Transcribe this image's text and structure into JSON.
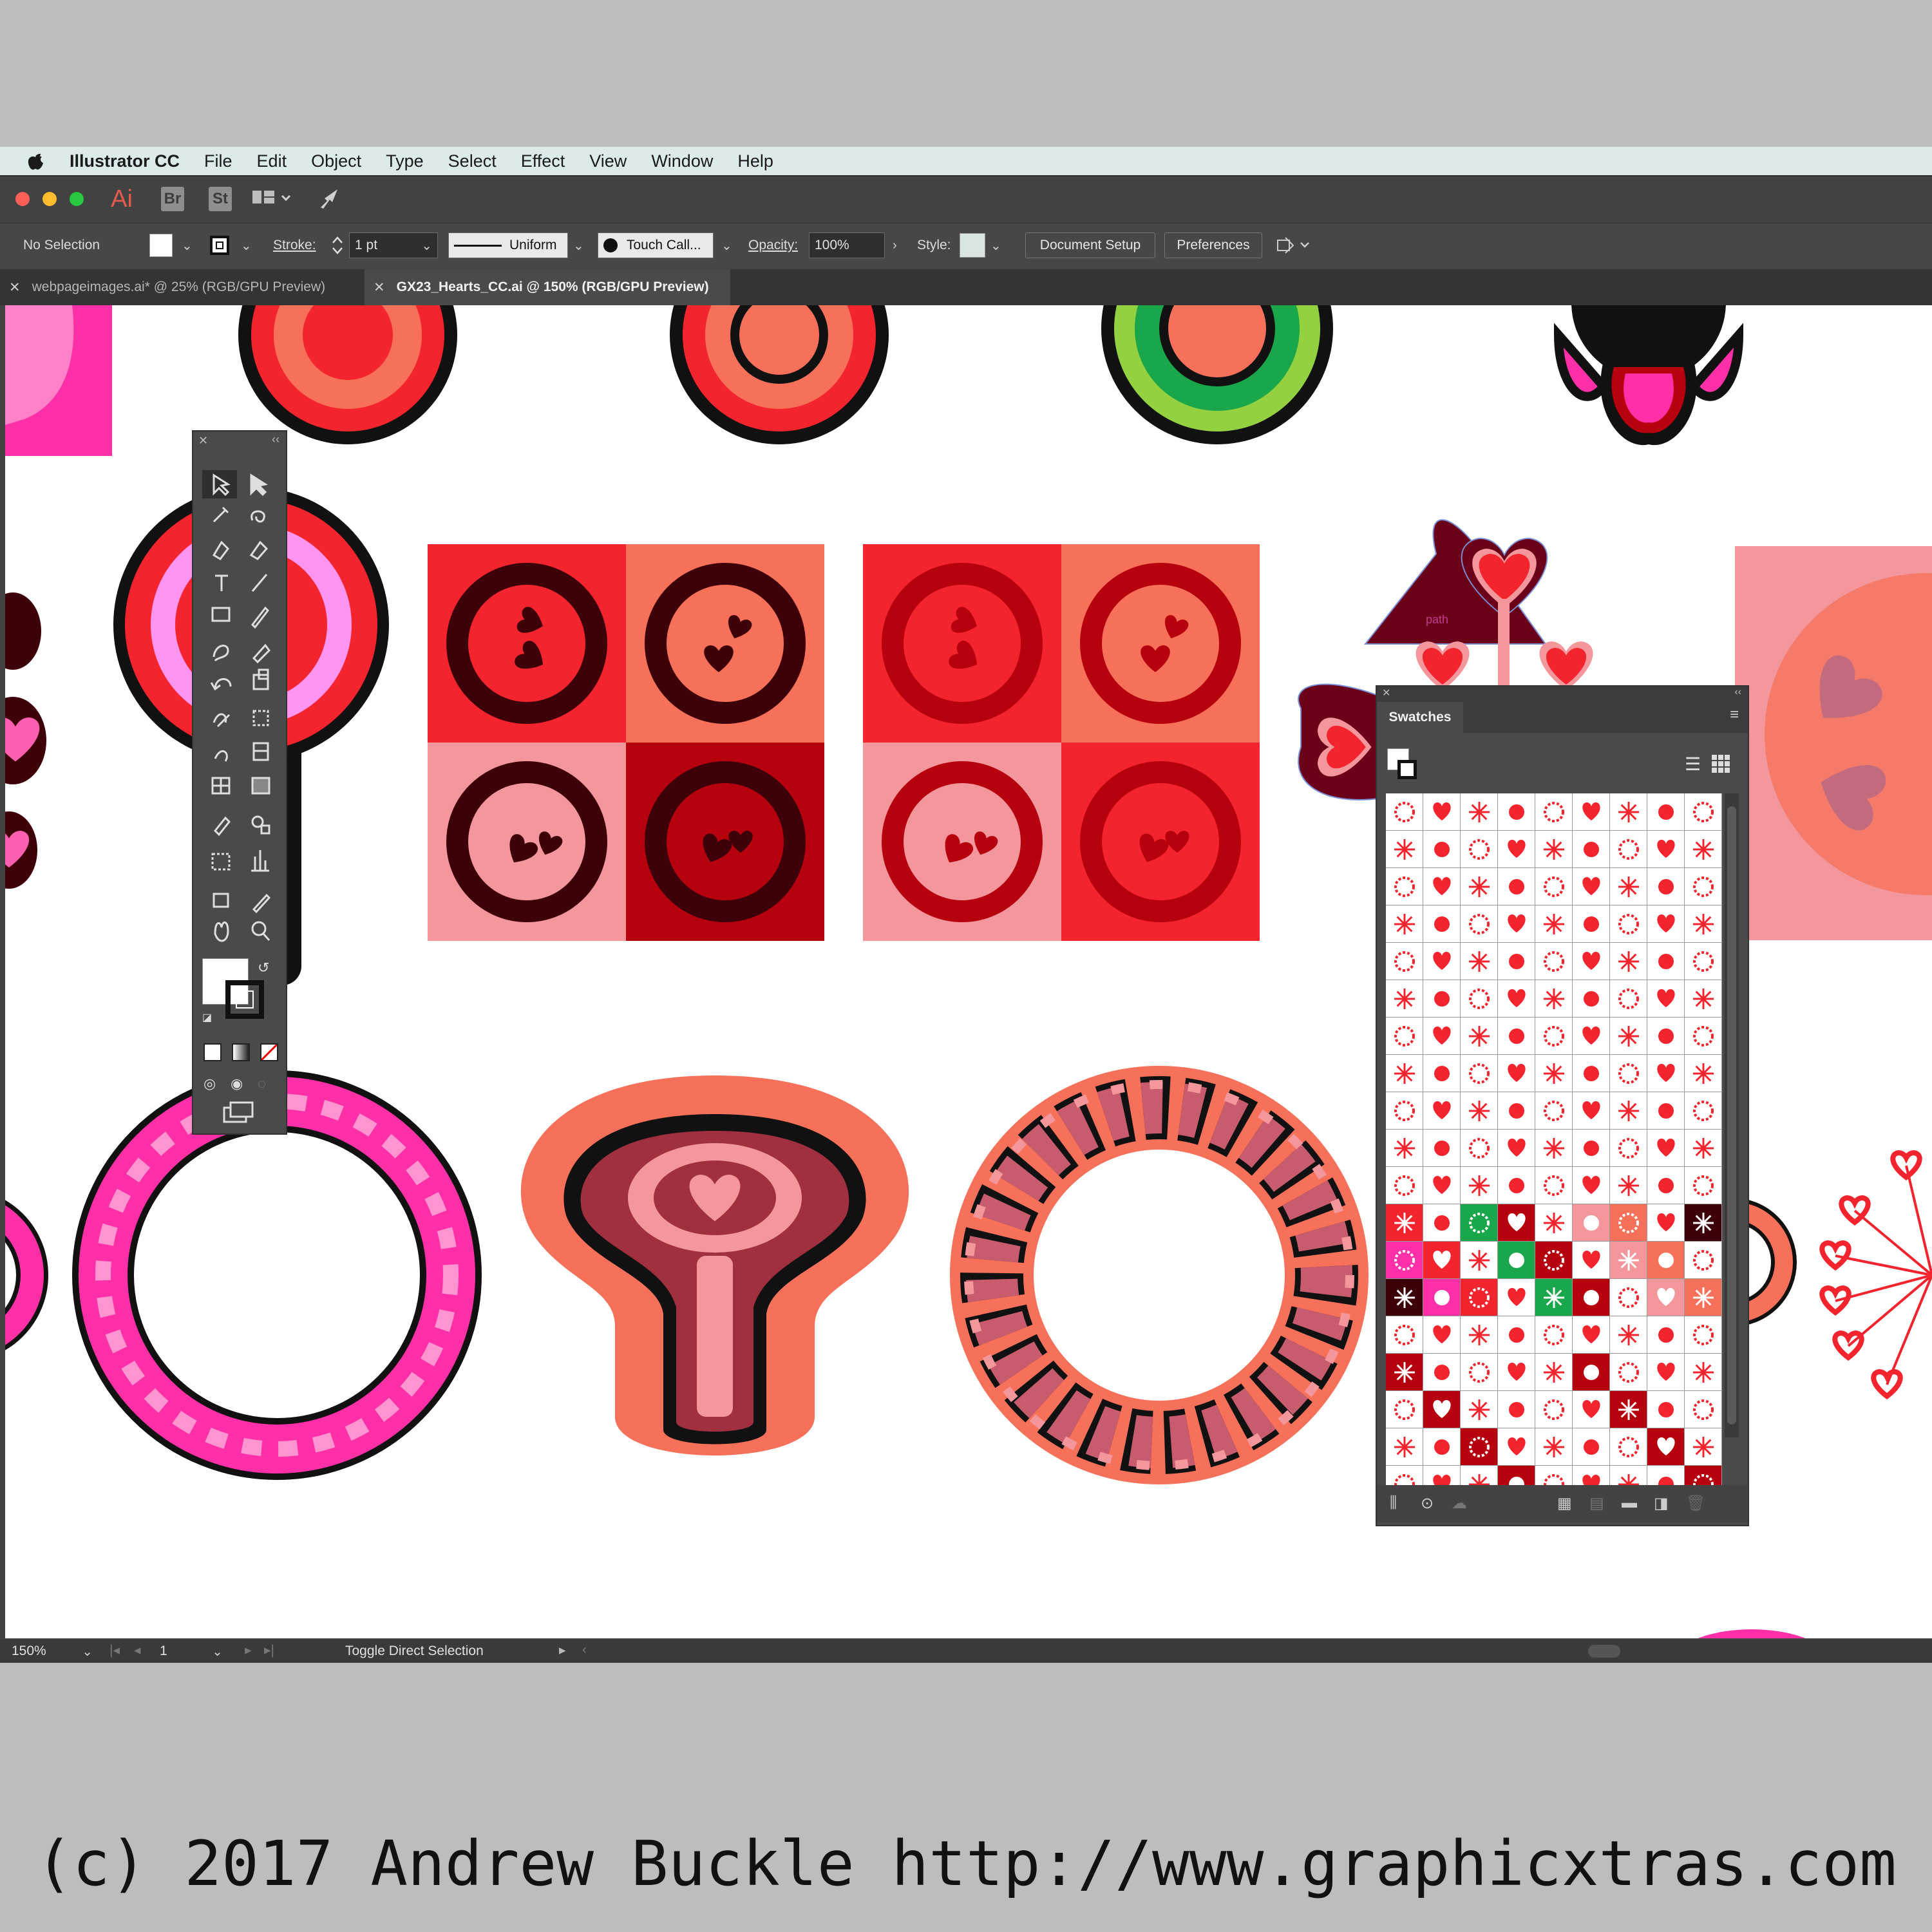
{
  "menubar": {
    "app_name": "Illustrator CC",
    "items": [
      "File",
      "Edit",
      "Object",
      "Type",
      "Select",
      "Effect",
      "View",
      "Window",
      "Help"
    ]
  },
  "appbar": {
    "logo": "Ai",
    "bridge": "Br",
    "stock": "St"
  },
  "control_bar": {
    "selection_status": "No Selection",
    "stroke_label": "Stroke:",
    "stroke_value": "1 pt",
    "profile": "Uniform",
    "brush": "Touch Call...",
    "opacity_label": "Opacity:",
    "opacity_value": "100%",
    "style_label": "Style:",
    "document_setup": "Document Setup",
    "preferences": "Preferences"
  },
  "tabs": [
    {
      "label": "webpageimages.ai* @ 25% (RGB/GPU Preview)"
    },
    {
      "label": "GX23_Hearts_CC.ai @ 150% (RGB/GPU Preview)"
    }
  ],
  "statusbar": {
    "zoom": "150%",
    "artboard": "1",
    "status_text": "Toggle Direct Selection"
  },
  "swatches_panel": {
    "title": "Swatches"
  },
  "canvas": {
    "path_label": "path"
  },
  "colors": {
    "red": "#f3242d",
    "salmon": "#f6705a",
    "pink": "#f4979c",
    "crimson": "#b7000d",
    "maroon": "#3d0009",
    "magenta": "#ff2fa8",
    "green": "#1aa64a"
  },
  "footer": {
    "copyright": "(c) 2017 Andrew Buckle http://www.graphicxtras.com"
  }
}
